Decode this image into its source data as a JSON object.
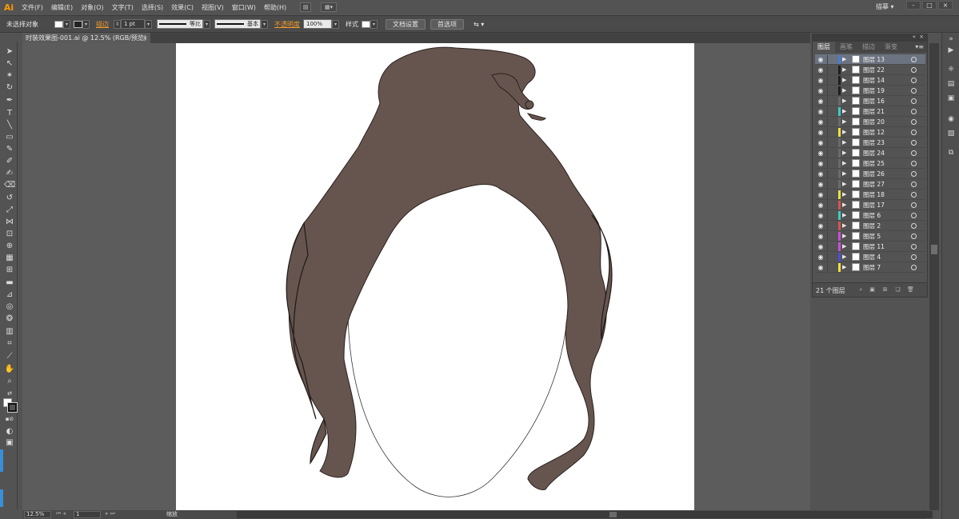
{
  "app": {
    "logo": "Ai",
    "menus": [
      "文件(F)",
      "编辑(E)",
      "对象(O)",
      "文字(T)",
      "选择(S)",
      "效果(C)",
      "视图(V)",
      "窗口(W)",
      "帮助(H)"
    ],
    "workspace": "描摹 ▾",
    "window_buttons": [
      "-",
      "□",
      "×"
    ]
  },
  "control_bar": {
    "selection_status": "未选择对象",
    "stroke_label": "描边",
    "stroke_weight": "1 pt",
    "profile_label": "等比",
    "brush_label": "基本",
    "opacity_label": "不透明度",
    "opacity_value": "100%",
    "style_label": "样式",
    "doc_setup_button": "文档设置",
    "preferences_button": "首选项"
  },
  "document_tab": {
    "title": "时装效果图-001.ai @ 12.5% (RGB/预览)",
    "close": "×"
  },
  "status_bar": {
    "zoom": "12.5%",
    "artboard": "1",
    "tool_status": "缩放"
  },
  "layers_panel": {
    "tabs": [
      "图层",
      "画笔",
      "描边",
      "渐变"
    ],
    "active_tab": "图层",
    "count_label": "21 个图层",
    "layers": [
      {
        "name": "图层 13",
        "color": "#4a7bd6",
        "selected": true
      },
      {
        "name": "图层 22",
        "color": "#1f1f1f",
        "selected": false
      },
      {
        "name": "图层 14",
        "color": "#1f1f1f",
        "selected": false
      },
      {
        "name": "图层 19",
        "color": "#1f1f1f",
        "selected": false
      },
      {
        "name": "图层 16",
        "color": "#6a6a6a",
        "selected": false
      },
      {
        "name": "图层 21",
        "color": "#3fc9c4",
        "selected": false
      },
      {
        "name": "图层 20",
        "color": "#6a6a6a",
        "selected": false
      },
      {
        "name": "图层 12",
        "color": "#f0e040",
        "selected": false
      },
      {
        "name": "图层 23",
        "color": "#6a6a6a",
        "selected": false
      },
      {
        "name": "图层 24",
        "color": "#6a6a6a",
        "selected": false
      },
      {
        "name": "图层 25",
        "color": "#6a6a6a",
        "selected": false
      },
      {
        "name": "图层 26",
        "color": "#6a6a6a",
        "selected": false
      },
      {
        "name": "图层 27",
        "color": "#6a6a6a",
        "selected": false
      },
      {
        "name": "图层 18",
        "color": "#f0e040",
        "selected": false
      },
      {
        "name": "图层 17",
        "color": "#d9534f",
        "selected": false
      },
      {
        "name": "图层 6",
        "color": "#3fc9c4",
        "selected": false
      },
      {
        "name": "图层 2",
        "color": "#d9534f",
        "selected": false
      },
      {
        "name": "图层 5",
        "color": "#c94fd9",
        "selected": false
      },
      {
        "name": "图层 11",
        "color": "#c94fd9",
        "selected": false
      },
      {
        "name": "图层 4",
        "color": "#4a4fd9",
        "selected": false
      },
      {
        "name": "图层 7",
        "color": "#f0e040",
        "selected": false
      }
    ]
  },
  "colors": {
    "hair_fill": "#66554e",
    "accent_orange": "#f09b2a",
    "selection_blue": "#6b7380"
  }
}
